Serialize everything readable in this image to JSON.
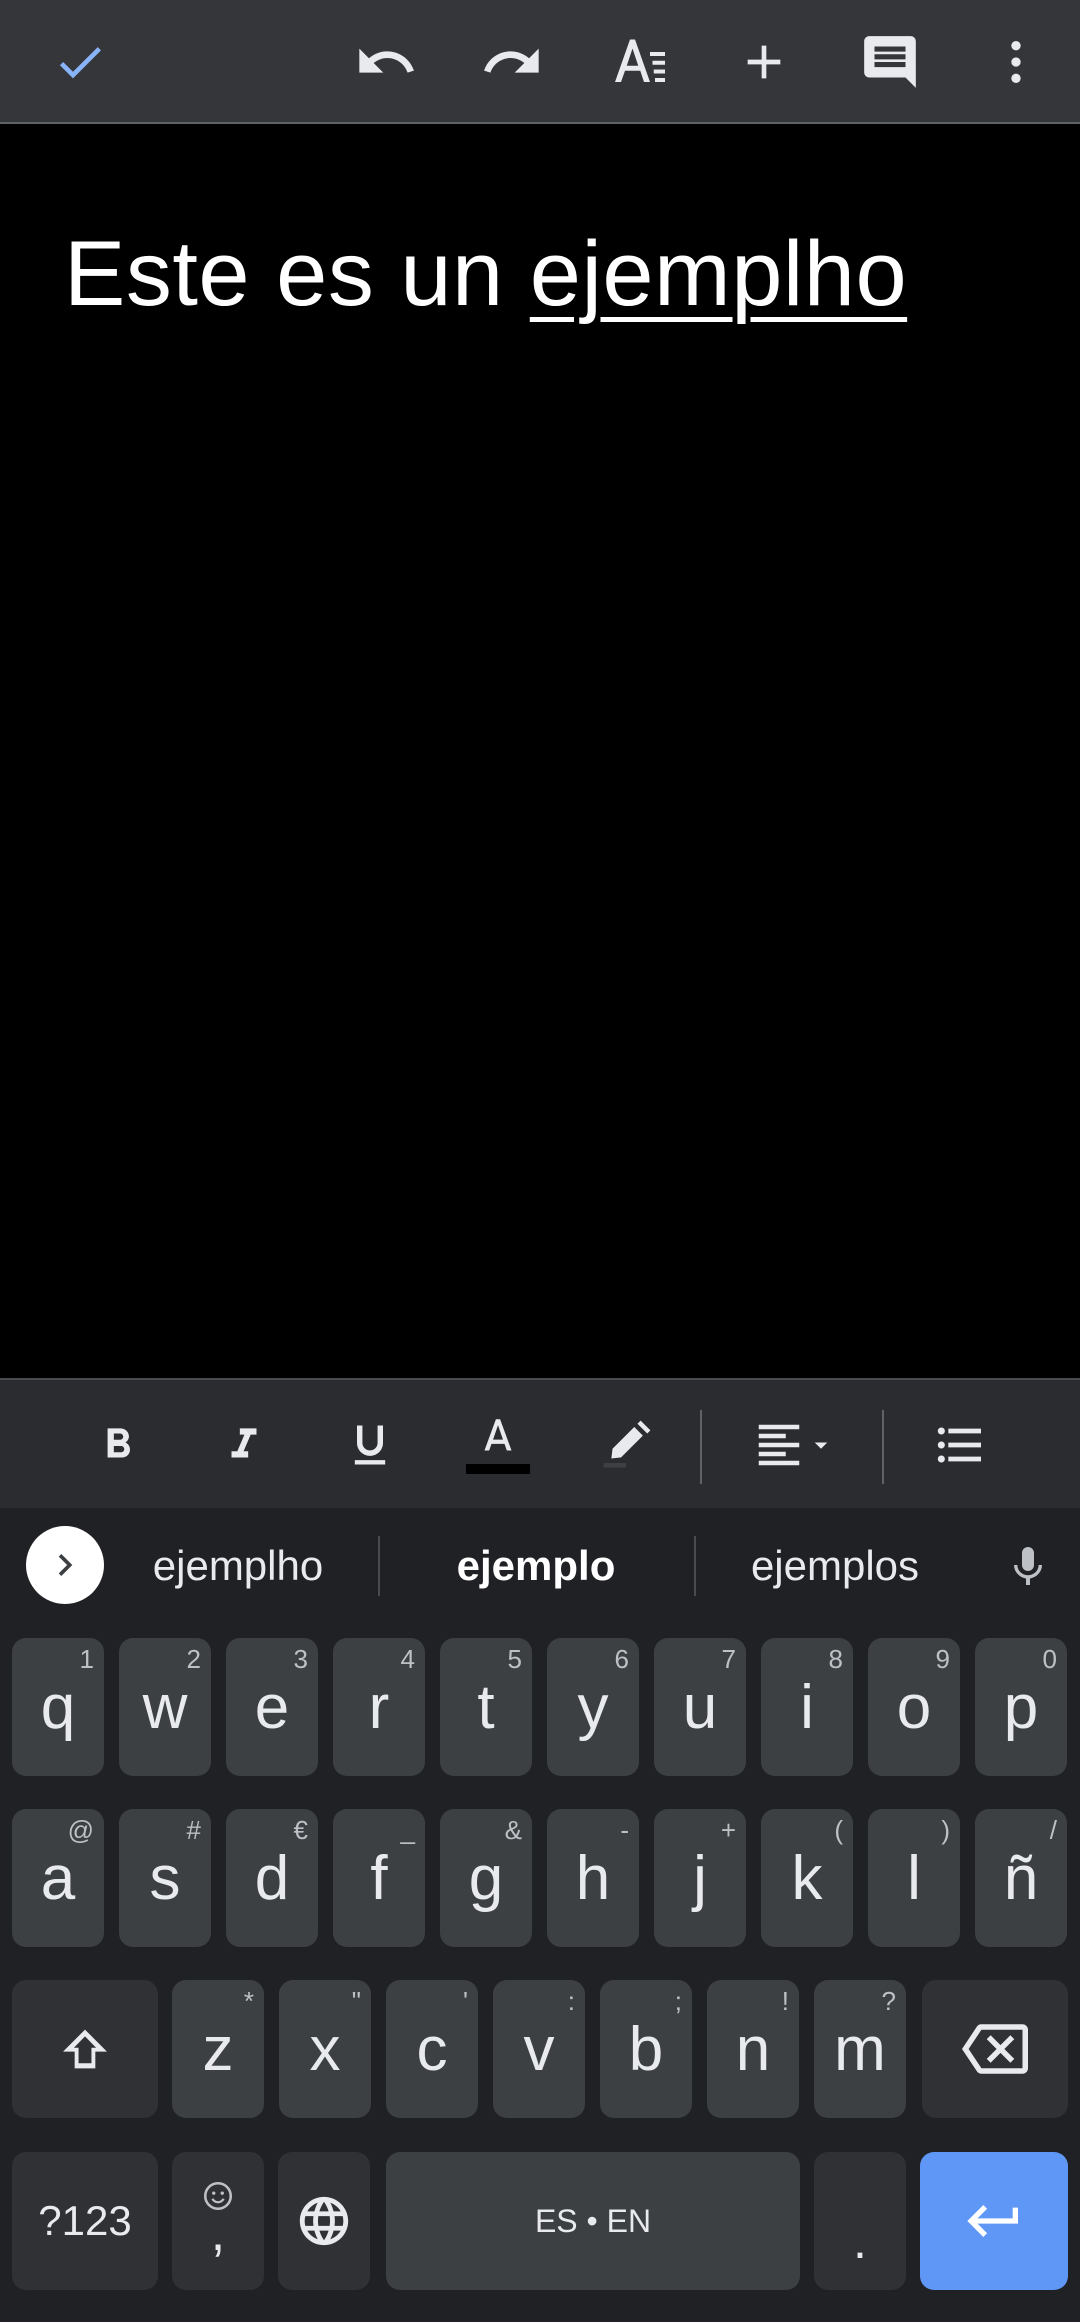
{
  "toolbar": {
    "icons": [
      "check-icon",
      "undo-icon",
      "redo-icon",
      "text-format-icon",
      "insert-icon",
      "comment-icon",
      "more-vert-icon"
    ],
    "accent_color": "#8ab4f8"
  },
  "document": {
    "text_before": "Este es un ",
    "misspelled_word": "ejemplho"
  },
  "format_bar": {
    "icons": [
      "bold-icon",
      "italic-icon",
      "underline-icon",
      "text-color-icon",
      "highlight-icon",
      "align-left-icon",
      "bulleted-list-icon"
    ],
    "text_color_swatch": "#000000"
  },
  "keyboard": {
    "suggestions": [
      "ejemplho",
      "ejemplo",
      "ejemplos"
    ],
    "row1": [
      {
        "key": "q",
        "hint": "1"
      },
      {
        "key": "w",
        "hint": "2"
      },
      {
        "key": "e",
        "hint": "3"
      },
      {
        "key": "r",
        "hint": "4"
      },
      {
        "key": "t",
        "hint": "5"
      },
      {
        "key": "y",
        "hint": "6"
      },
      {
        "key": "u",
        "hint": "7"
      },
      {
        "key": "i",
        "hint": "8"
      },
      {
        "key": "o",
        "hint": "9"
      },
      {
        "key": "p",
        "hint": "0"
      }
    ],
    "row2": [
      {
        "key": "a",
        "hint": "@"
      },
      {
        "key": "s",
        "hint": "#"
      },
      {
        "key": "d",
        "hint": "€"
      },
      {
        "key": "f",
        "hint": "_"
      },
      {
        "key": "g",
        "hint": "&"
      },
      {
        "key": "h",
        "hint": "-"
      },
      {
        "key": "j",
        "hint": "+"
      },
      {
        "key": "k",
        "hint": "("
      },
      {
        "key": "l",
        "hint": ")"
      },
      {
        "key": "ñ",
        "hint": "/"
      }
    ],
    "row3": [
      {
        "key": "z",
        "hint": "*"
      },
      {
        "key": "x",
        "hint": "\""
      },
      {
        "key": "c",
        "hint": "'"
      },
      {
        "key": "v",
        "hint": ":"
      },
      {
        "key": "b",
        "hint": ";"
      },
      {
        "key": "n",
        "hint": "!"
      },
      {
        "key": "m",
        "hint": "?"
      }
    ],
    "symbols_label": "?123",
    "comma_label": ",",
    "space_label": "ES • EN",
    "period_label": ".",
    "enter_color": "#5e97f6"
  }
}
